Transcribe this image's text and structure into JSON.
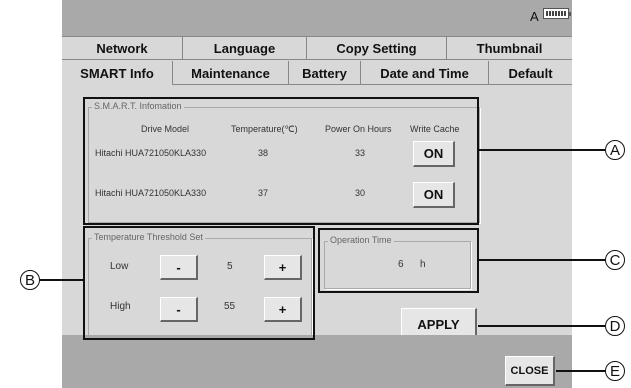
{
  "status": {
    "indicator_label": "A",
    "battery_icon": "battery-icon"
  },
  "tabs_row1": [
    "Network",
    "Language",
    "Copy Setting",
    "Thumbnail"
  ],
  "tabs_row2": [
    "SMART Info",
    "Maintenance",
    "Battery",
    "Date and Time",
    "Default"
  ],
  "active_tab": "SMART Info",
  "smart": {
    "legend": "S.M.A.R.T. Infomation",
    "headers": [
      "Drive Model",
      "Temperature(℃)",
      "Power On Hours",
      "Write Cache"
    ],
    "rows": [
      {
        "model": "Hitachi HUA721050KLA330",
        "temperature": "38",
        "hours": "33",
        "cache": "ON"
      },
      {
        "model": "Hitachi HUA721050KLA330",
        "temperature": "37",
        "hours": "30",
        "cache": "ON"
      }
    ]
  },
  "threshold": {
    "legend": "Temperature Threshold Set",
    "low_label": "Low",
    "low_value": "5",
    "high_label": "High",
    "high_value": "55",
    "minus": "-",
    "plus": "+"
  },
  "operation": {
    "legend": "Operation Time",
    "value": "6",
    "unit": "h"
  },
  "apply_label": "APPLY",
  "close_label": "CLOSE",
  "callouts": [
    "A",
    "B",
    "C",
    "D",
    "E"
  ]
}
